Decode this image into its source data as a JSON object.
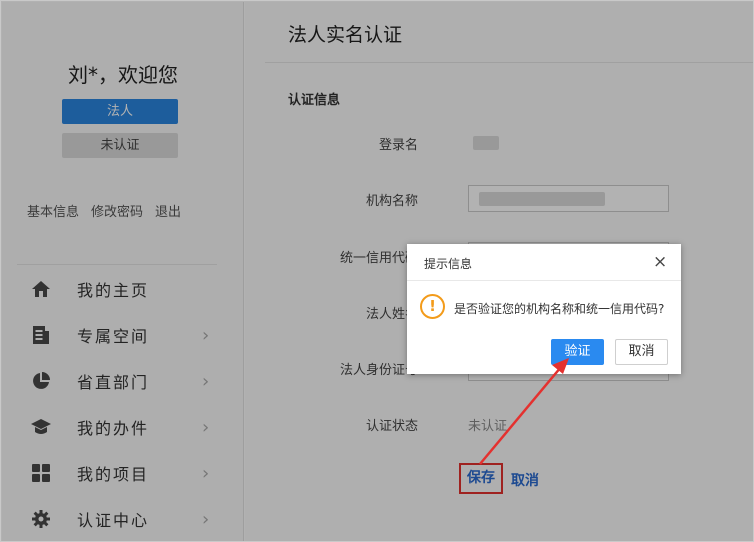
{
  "sidebar": {
    "welcome": "刘*，欢迎您",
    "role_badge": "法人",
    "status_badge": "未认证",
    "links": [
      "基本信息",
      "修改密码",
      "退出"
    ],
    "nav": [
      {
        "label": "我的主页",
        "icon": "home-icon",
        "chevron": false
      },
      {
        "label": "专属空间",
        "icon": "document-icon",
        "chevron": true
      },
      {
        "label": "省直部门",
        "icon": "pie-chart-icon",
        "chevron": true
      },
      {
        "label": "我的办件",
        "icon": "graduation-cap-icon",
        "chevron": true
      },
      {
        "label": "我的项目",
        "icon": "grid-icon",
        "chevron": true
      },
      {
        "label": "认证中心",
        "icon": "gear-icon",
        "chevron": true
      }
    ]
  },
  "main": {
    "page_title": "法人实名认证",
    "section_title": "认证信息",
    "fields": {
      "login_name": "登录名",
      "org_name": "机构名称",
      "credit_code": "统一信用代码",
      "legal_name": "法人姓名",
      "legal_id": "法人身份证号",
      "status": "认证状态"
    },
    "status_value": "未认证",
    "save_label": "保存",
    "cancel_label": "取消"
  },
  "dialog": {
    "title": "提示信息",
    "close": "×",
    "warn": "!",
    "message": "是否验证您的机构名称和统一信用代码?",
    "confirm_label": "验证",
    "cancel_label": "取消"
  },
  "colors": {
    "primary": "#2a86e0",
    "highlight": "#e4312f",
    "warning": "#f39b1a"
  }
}
